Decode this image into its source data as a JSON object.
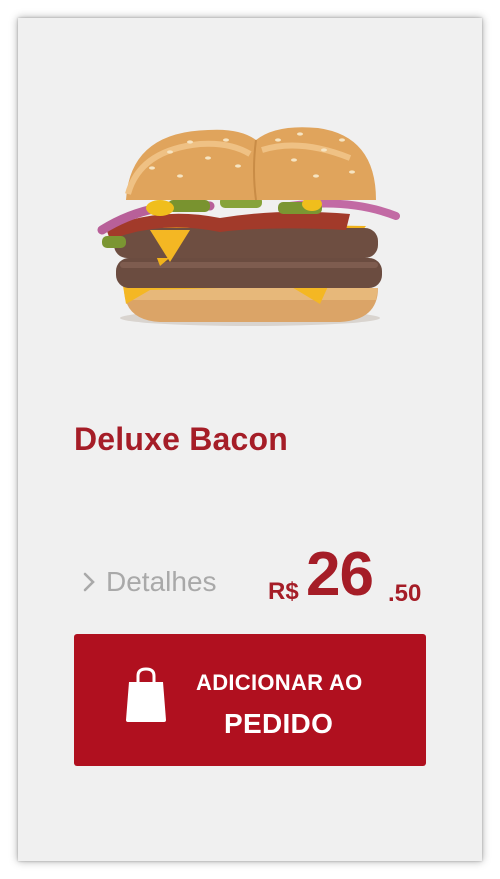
{
  "product": {
    "name": "Deluxe Bacon",
    "image_icon": "deluxe-bacon-burger",
    "details_label": "Detalhes",
    "price": {
      "currency": "R$",
      "integer": "26",
      "decimal": ".50"
    }
  },
  "add_button": {
    "line1": "ADICIONAR AO",
    "line2": "PEDIDO",
    "icon": "shopping-bag-icon"
  },
  "colors": {
    "brand_red": "#a51d27",
    "button_red": "#b0101f",
    "card_background": "#f0f0f0",
    "details_gray": "#a9a9a9"
  }
}
